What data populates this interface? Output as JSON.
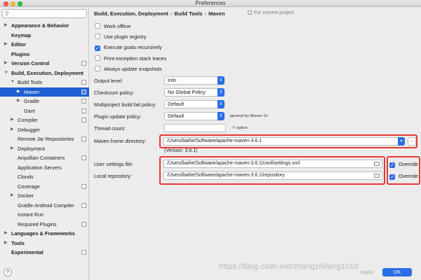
{
  "window": {
    "title": "Preferences"
  },
  "sidebar": {
    "search_icon": "search-icon",
    "items": [
      {
        "label": "Appearance & Behavior",
        "bold": true,
        "arrow": "▶",
        "level": 0,
        "proj": false
      },
      {
        "label": "Keymap",
        "bold": true,
        "arrow": "",
        "level": 0,
        "proj": false
      },
      {
        "label": "Editor",
        "bold": true,
        "arrow": "▶",
        "level": 0,
        "proj": false
      },
      {
        "label": "Plugins",
        "bold": true,
        "arrow": "",
        "level": 0,
        "proj": false
      },
      {
        "label": "Version Control",
        "bold": true,
        "arrow": "▶",
        "level": 0,
        "proj": true
      },
      {
        "label": "Build, Execution, Deployment",
        "bold": true,
        "arrow": "▼",
        "level": 0,
        "proj": false
      },
      {
        "label": "Build Tools",
        "bold": false,
        "arrow": "▼",
        "level": 1,
        "proj": true
      },
      {
        "label": "Maven",
        "bold": false,
        "arrow": "▶",
        "level": 2,
        "proj": true,
        "selected": true
      },
      {
        "label": "Gradle",
        "bold": false,
        "arrow": "▶",
        "level": 2,
        "proj": true
      },
      {
        "label": "Gant",
        "bold": false,
        "arrow": "",
        "level": 2,
        "proj": true
      },
      {
        "label": "Compiler",
        "bold": false,
        "arrow": "▶",
        "level": 1,
        "proj": true
      },
      {
        "label": "Debugger",
        "bold": false,
        "arrow": "▶",
        "level": 1,
        "proj": false
      },
      {
        "label": "Remote Jar Repositories",
        "bold": false,
        "arrow": "",
        "level": 1,
        "proj": true
      },
      {
        "label": "Deployment",
        "bold": false,
        "arrow": "▶",
        "level": 1,
        "proj": false
      },
      {
        "label": "Arquillian Containers",
        "bold": false,
        "arrow": "",
        "level": 1,
        "proj": true
      },
      {
        "label": "Application Servers",
        "bold": false,
        "arrow": "",
        "level": 1,
        "proj": false
      },
      {
        "label": "Clouds",
        "bold": false,
        "arrow": "",
        "level": 1,
        "proj": false
      },
      {
        "label": "Coverage",
        "bold": false,
        "arrow": "",
        "level": 1,
        "proj": true
      },
      {
        "label": "Docker",
        "bold": false,
        "arrow": "▶",
        "level": 1,
        "proj": false
      },
      {
        "label": "Gradle-Android Compiler",
        "bold": false,
        "arrow": "",
        "level": 1,
        "proj": true
      },
      {
        "label": "Instant Run",
        "bold": false,
        "arrow": "",
        "level": 1,
        "proj": false
      },
      {
        "label": "Required Plugins",
        "bold": false,
        "arrow": "",
        "level": 1,
        "proj": true
      },
      {
        "label": "Languages & Frameworks",
        "bold": true,
        "arrow": "▶",
        "level": 0,
        "proj": false
      },
      {
        "label": "Tools",
        "bold": true,
        "arrow": "▶",
        "level": 0,
        "proj": false
      },
      {
        "label": "Experimental",
        "bold": true,
        "arrow": "",
        "level": 0,
        "proj": true
      }
    ],
    "help_label": "?"
  },
  "breadcrumb": {
    "parts": [
      "Build, Execution, Deployment",
      "Build Tools",
      "Maven"
    ],
    "separator": "›",
    "scope": "For current project"
  },
  "options": [
    {
      "label": "Work offline",
      "checked": false
    },
    {
      "label": "Use plugin registry",
      "checked": false
    },
    {
      "label": "Execute goals recursively",
      "checked": true
    },
    {
      "label": "Print exception stack traces",
      "checked": false
    },
    {
      "label": "Always update snapshots",
      "checked": false
    }
  ],
  "fields": {
    "output_level": {
      "label": "Output level:",
      "value": "Info"
    },
    "checksum_policy": {
      "label": "Checksum policy:",
      "value": "No Global Policy"
    },
    "multiproject_fail_policy": {
      "label": "Multiproject build fail policy:",
      "value": "Default"
    },
    "plugin_update_policy": {
      "label": "Plugin update policy:",
      "value": "Default",
      "hint": "ignored by Maven 3+"
    },
    "thread_count": {
      "label": "Thread count:",
      "value": "",
      "hint": "-T option"
    },
    "maven_home": {
      "label": "Maven home directory:",
      "value": "/Users/baihe/Software/apache-maven-3.6.1",
      "version": "(Version: 3.6.1)",
      "more": "..."
    },
    "user_settings": {
      "label": "User settings file:",
      "value": "/Users/baihe/Software/apache-maven-3.6.1/conf/settings.xml",
      "override_label": "Override",
      "override_checked": true
    },
    "local_repo": {
      "label": "Local repository:",
      "value": "/Users/baihe/Software/apache-maven-3.6.1/repository",
      "override_label": "Override",
      "override_checked": true
    }
  },
  "footer": {
    "watermark": "https://blog.csdn.net/zhangzhifang1010",
    "apply_label": "Apply",
    "ok_label": "OK"
  },
  "colors": {
    "accent": "#2b6de5",
    "selection": "#1f5fd1",
    "highlight_box": "#e53935"
  }
}
